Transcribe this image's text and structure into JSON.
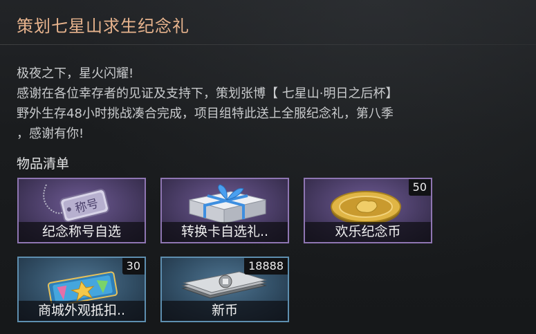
{
  "title": "策划七星山求生纪念礼",
  "message": {
    "lines": [
      "极夜之下，星火闪耀!",
      "感谢在各位幸存者的见证及支持下，策划张博【 七星山·明日之后杯】",
      "野外生存48小时挑战凑合完成，项目组特此送上全服纪念礼，第八季",
      "，感谢有你!"
    ]
  },
  "item_list": {
    "title": "物品清单",
    "items": [
      {
        "label": "纪念称号自选",
        "count": "",
        "icon": "title-tag-icon",
        "tag_text": "称号",
        "rarity": "purple"
      },
      {
        "label": "转换卡自选礼..",
        "count": "",
        "icon": "gift-box-icon",
        "rarity": "purple"
      },
      {
        "label": "欢乐纪念币",
        "count": "50",
        "icon": "gold-coin-icon",
        "rarity": "purple"
      },
      {
        "label": "商城外观抵扣..",
        "count": "30",
        "icon": "coupon-ticket-icon",
        "rarity": "blue"
      },
      {
        "label": "新币",
        "count": "18888",
        "icon": "cash-stack-icon",
        "rarity": "blue"
      }
    ]
  },
  "colors": {
    "title": "#e7b38d",
    "purple_border": "#8f76b3",
    "blue_border": "#5e8fb0"
  }
}
